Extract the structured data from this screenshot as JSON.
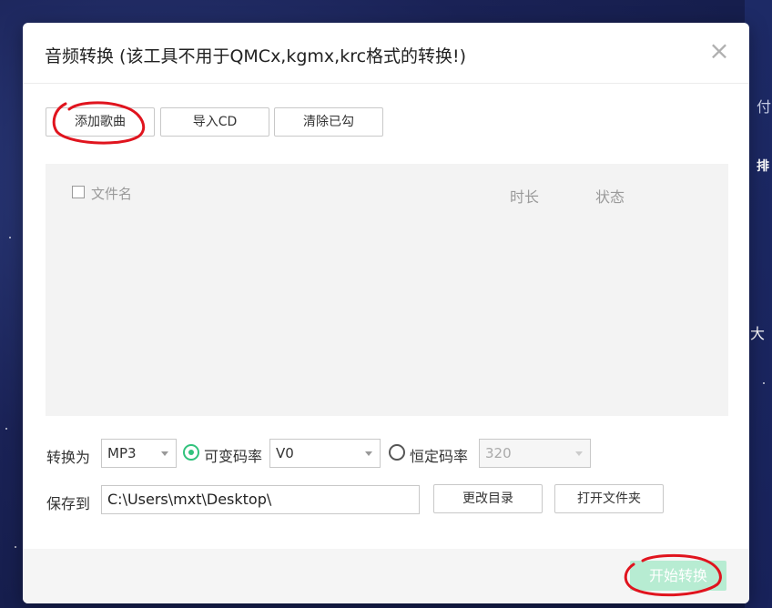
{
  "dialog": {
    "title": "音频转换 (该工具不用于QMCx,kgmx,krc格式的转换!)",
    "close_icon": "close-icon"
  },
  "toolbar": {
    "add_song": "添加歌曲",
    "import_cd": "导入CD",
    "clear_checked": "清除已勾"
  },
  "list": {
    "columns": [
      "文件名",
      "时长",
      "状态"
    ],
    "rows": []
  },
  "convert": {
    "label": "转换为",
    "format": "MP3",
    "vbr_label": "可变码率",
    "vbr_value": "V0",
    "cbr_label": "恒定码率",
    "cbr_value": "320",
    "selected_mode": "vbr"
  },
  "save": {
    "label": "保存到",
    "path": "C:\\Users\\mxt\\Desktop\\",
    "change_dir": "更改目录",
    "open_folder": "打开文件夹"
  },
  "footer": {
    "start": "开始转换"
  },
  "background": {
    "side_texts": [
      "付",
      "排",
      "大"
    ]
  },
  "colors": {
    "accent": "#31c27c",
    "start_disabled": "#b7ecd2",
    "annotation": "#e0141e"
  }
}
